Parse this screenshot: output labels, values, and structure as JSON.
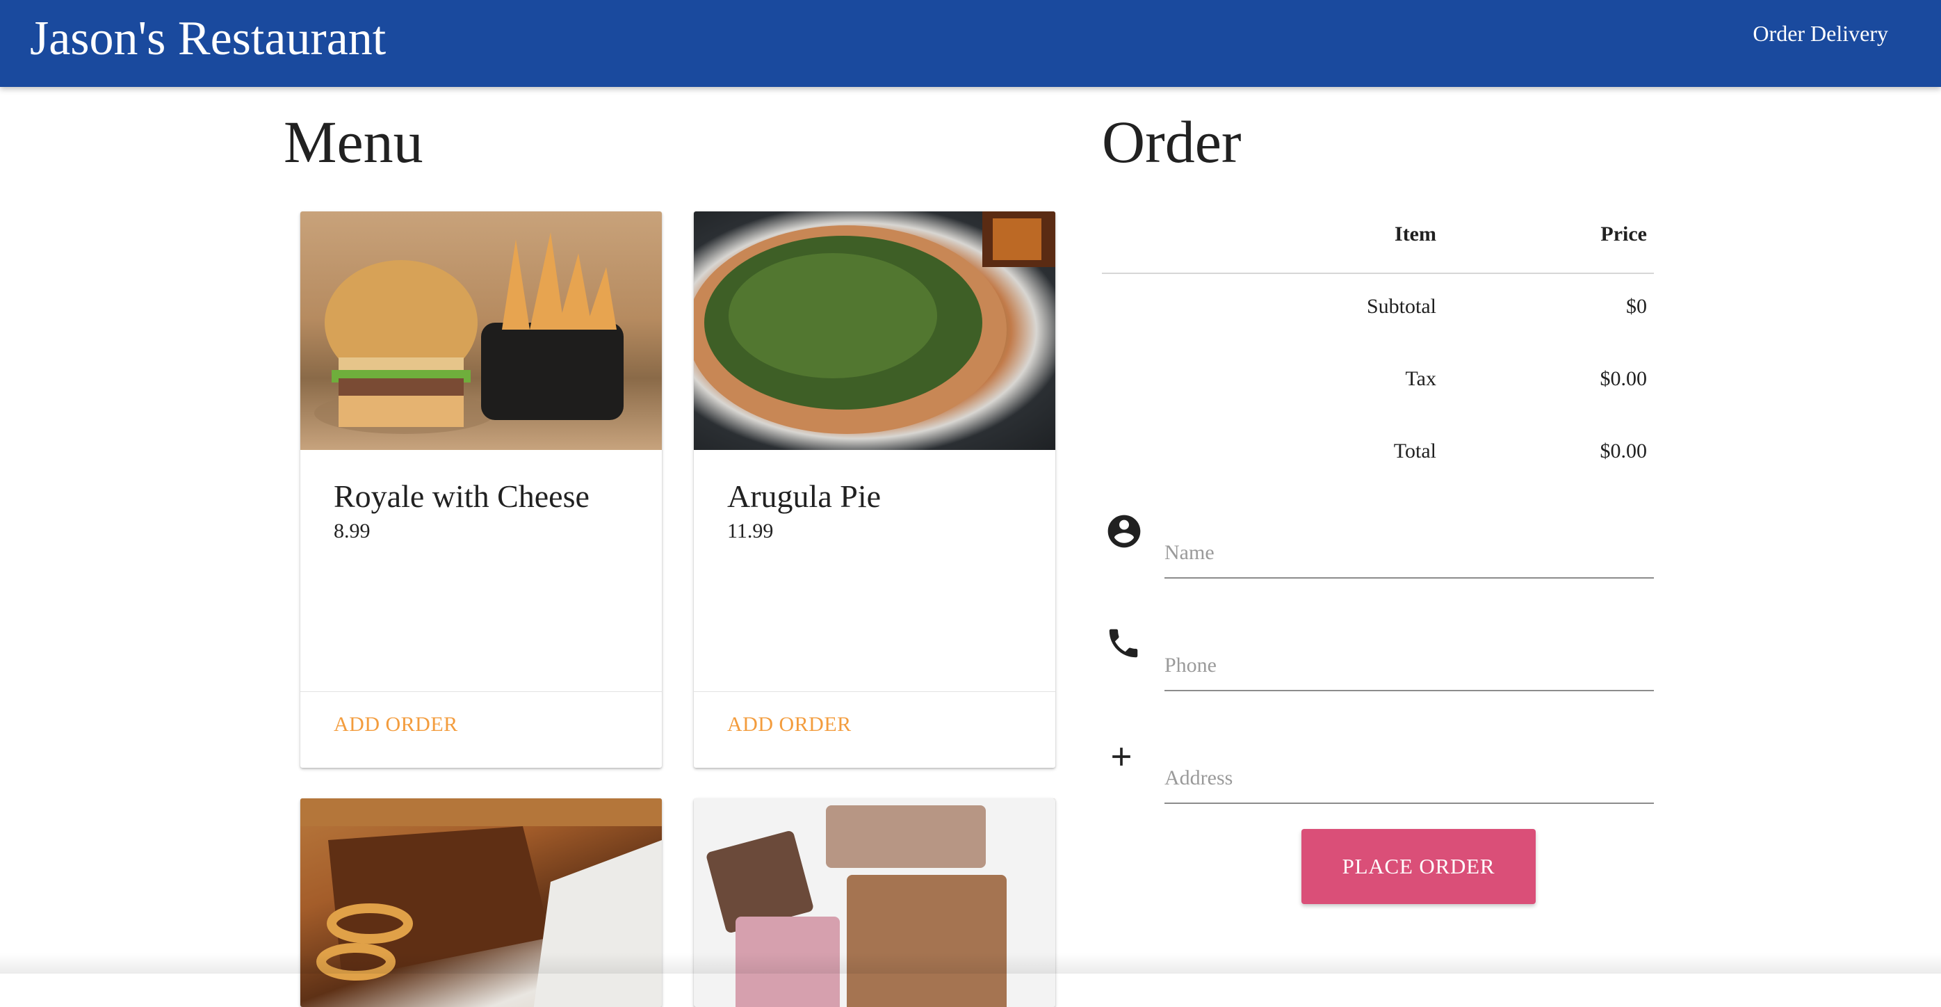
{
  "appbar": {
    "brand": "Jason's Restaurant",
    "nav_link": "Order Delivery"
  },
  "menu": {
    "title": "Menu",
    "items": [
      {
        "name": "Royale with Cheese",
        "price": "8.99",
        "action": "ADD ORDER"
      },
      {
        "name": "Arugula Pie",
        "price": "11.99",
        "action": "ADD ORDER"
      },
      {
        "name": "",
        "price": "",
        "action": ""
      },
      {
        "name": "",
        "price": "",
        "action": ""
      }
    ]
  },
  "order": {
    "title": "Order",
    "table": {
      "headers": {
        "item": "Item",
        "price": "Price"
      },
      "rows": [
        {
          "label": "Subtotal",
          "value": "$0"
        },
        {
          "label": "Tax",
          "value": "$0.00"
        },
        {
          "label": "Total",
          "value": "$0.00"
        }
      ]
    },
    "fields": {
      "name": {
        "placeholder": "Name",
        "value": ""
      },
      "phone": {
        "placeholder": "Phone",
        "value": ""
      },
      "address": {
        "placeholder": "Address",
        "value": ""
      }
    },
    "place_button": "PLACE ORDER"
  },
  "colors": {
    "appbar": "#1a4a9e",
    "accent": "#f39c3d",
    "button": "#da4f78"
  },
  "icons": {
    "name": "account-circle-icon",
    "phone": "phone-icon",
    "address": "plus-icon"
  }
}
